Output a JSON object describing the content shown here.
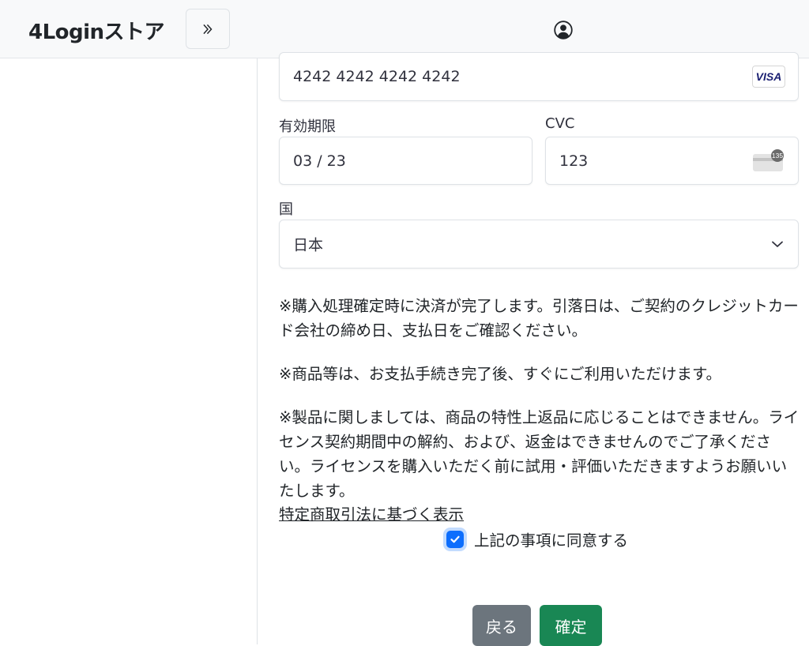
{
  "header": {
    "brand": "4Loginストア",
    "toggle_icon": "double-chevron-right-icon",
    "user_icon": "user-circle-icon"
  },
  "payment": {
    "card_number": "4242 4242 4242 4242",
    "card_brand": "VISA",
    "expiry_label": "有効期限",
    "expiry_value": "03 / 23",
    "cvc_label": "CVC",
    "cvc_value": "123",
    "cvc_icon_text": "135",
    "country_label": "国",
    "country_value": "日本"
  },
  "notices": {
    "line1": "※購入処理確定時に決済が完了します。引落日は、ご契約のクレジットカード会社の締め日、支払日をご確認ください。",
    "line2": "※商品等は、お支払手続き完了後、すぐにご利用いただけます。",
    "line3": "※製品に関しましては、商品の特性上返品に応じることはできません。ライセンス契約期間中の解約、および、返金はできませんのでご了承ください。ライセンスを購入いただく前に試用・評価いただきますようお願いいたします。"
  },
  "law_link": "特定商取引法に基づく表示",
  "agree": {
    "label": "上記の事項に同意する",
    "checked": true
  },
  "actions": {
    "back_label": "戻る",
    "confirm_label": "確定"
  },
  "colors": {
    "primary": "#0d6efd",
    "secondary": "#6c757d",
    "success": "#198754",
    "visa": "#1a1f71"
  }
}
